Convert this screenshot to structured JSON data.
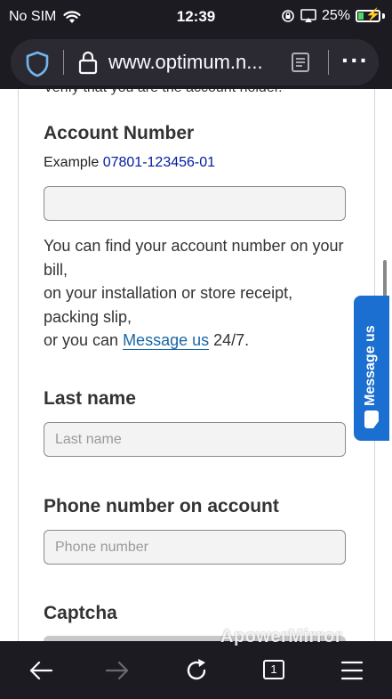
{
  "status_bar": {
    "carrier": "No SIM",
    "time": "12:39",
    "battery": "25%"
  },
  "browser": {
    "url": "www.optimum.n..."
  },
  "form": {
    "cutoff_text": "Verify that you are the account holder.",
    "account_number_label": "Account Number",
    "example_prefix": "Example ",
    "example_value": "07801-123456-01",
    "account_number_value": "",
    "help_line1": "You can find your account number on your bill,",
    "help_line2": "on your installation or store receipt, packing slip,",
    "help_prefix": "or you can ",
    "help_link": "Message us",
    "help_suffix": " 24/7.",
    "last_name_label": "Last name",
    "last_name_placeholder": "Last name",
    "phone_label": "Phone number on account",
    "phone_placeholder": "Phone number",
    "captcha_label": "Captcha"
  },
  "message_tab": {
    "label": "Message us"
  },
  "toolbar": {
    "tab_count": "1"
  },
  "watermark": "ApowerMirror",
  "colors": {
    "browser_chrome": "#1c1b22",
    "url_pill": "#2b2a33",
    "accent_blue": "#1a6fd1",
    "link": "#1a66a5",
    "example_number": "#001aa0"
  }
}
